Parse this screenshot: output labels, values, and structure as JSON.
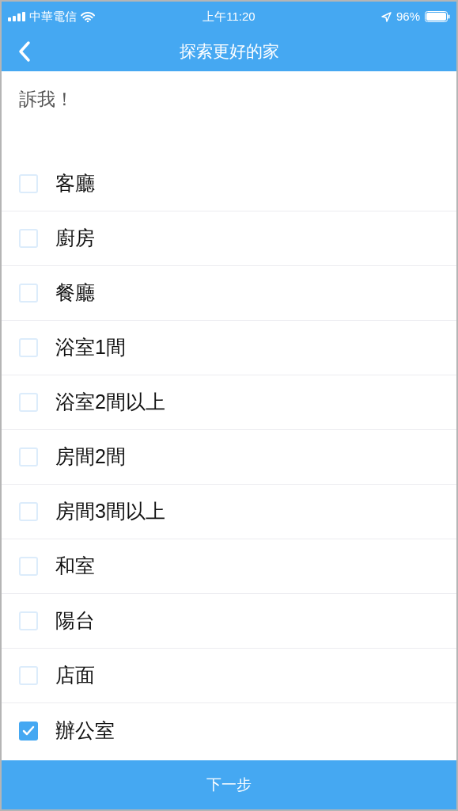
{
  "status_bar": {
    "carrier": "中華電信",
    "time": "上午11:20",
    "battery": "96%"
  },
  "nav": {
    "title": "探索更好的家"
  },
  "prompt": "訴我！",
  "options": [
    {
      "label": "客廳",
      "checked": false
    },
    {
      "label": "廚房",
      "checked": false
    },
    {
      "label": "餐廳",
      "checked": false
    },
    {
      "label": "浴室1間",
      "checked": false
    },
    {
      "label": "浴室2間以上",
      "checked": false
    },
    {
      "label": "房間2間",
      "checked": false
    },
    {
      "label": "房間3間以上",
      "checked": false
    },
    {
      "label": "和室",
      "checked": false
    },
    {
      "label": "陽台",
      "checked": false
    },
    {
      "label": "店面",
      "checked": false
    },
    {
      "label": "辦公室",
      "checked": true
    }
  ],
  "next_button": "下一步"
}
